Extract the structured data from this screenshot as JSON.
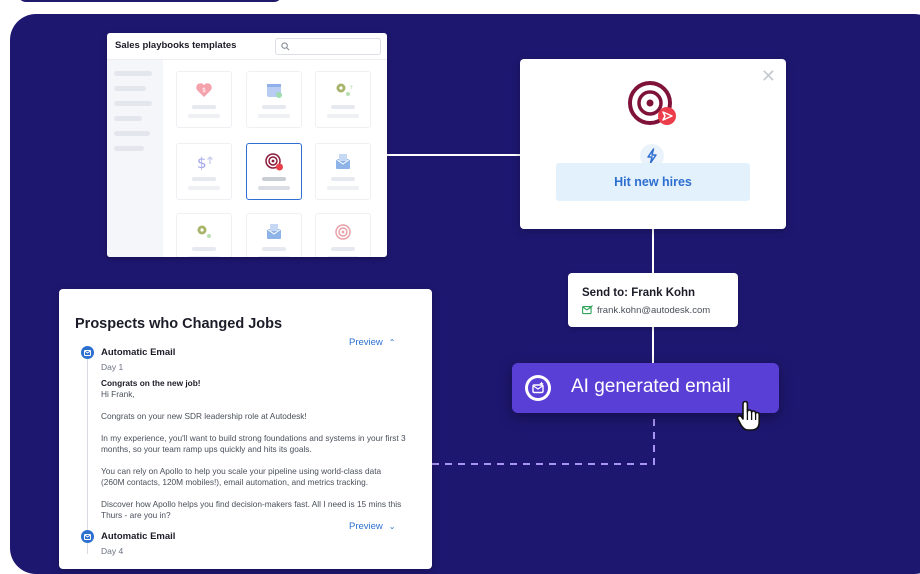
{
  "templates": {
    "title": "Sales playbooks templates",
    "search_placeholder": "",
    "tiles": [
      {
        "icon": "heart-icon"
      },
      {
        "icon": "calendar-icon"
      },
      {
        "icon": "gear-plus-icon"
      },
      {
        "icon": "dollar-up-icon"
      },
      {
        "icon": "target-send-icon",
        "selected": true
      },
      {
        "icon": "envelope-icon"
      },
      {
        "icon": "gear-plus-icon"
      },
      {
        "icon": "envelope-icon"
      },
      {
        "icon": "target-icon"
      }
    ]
  },
  "playbook": {
    "button_label": "Hit new hires",
    "accent": "#2d6fcf"
  },
  "recipient": {
    "label": "Send to: Frank Kohn",
    "email": "frank.kohn@autodesk.com"
  },
  "ai_button": {
    "label": "AI generated email",
    "color": "#5a3fd6"
  },
  "sequence": {
    "title": "Prospects who Changed Jobs",
    "steps": [
      {
        "name": "Automatic Email",
        "day": "Day 1",
        "toggle": "Preview",
        "expanded": true
      },
      {
        "name": "Automatic Email",
        "day": "Day 4",
        "toggle": "Preview",
        "expanded": false
      }
    ],
    "email": {
      "subject": "Congrats on the new job!",
      "greeting": "Hi Frank,",
      "p1": "Congrats on your new SDR leadership role at Autodesk!",
      "p2": "In my experience, you'll want to build strong foundations and systems in your first 3 months, so your team ramp ups quickly and hits its goals.",
      "p3": "You can rely on Apollo to help you scale your pipeline using world-class data (260M contacts, 120M mobiles!), email automation, and metrics tracking.",
      "p4": "Discover how Apollo helps you find decision-makers fast. All I need is 15 mins this Thurs - are you in?"
    }
  },
  "colors": {
    "background": "#1e1770",
    "link_blue": "#2d6fcf",
    "dashed_line": "#a794f5"
  }
}
